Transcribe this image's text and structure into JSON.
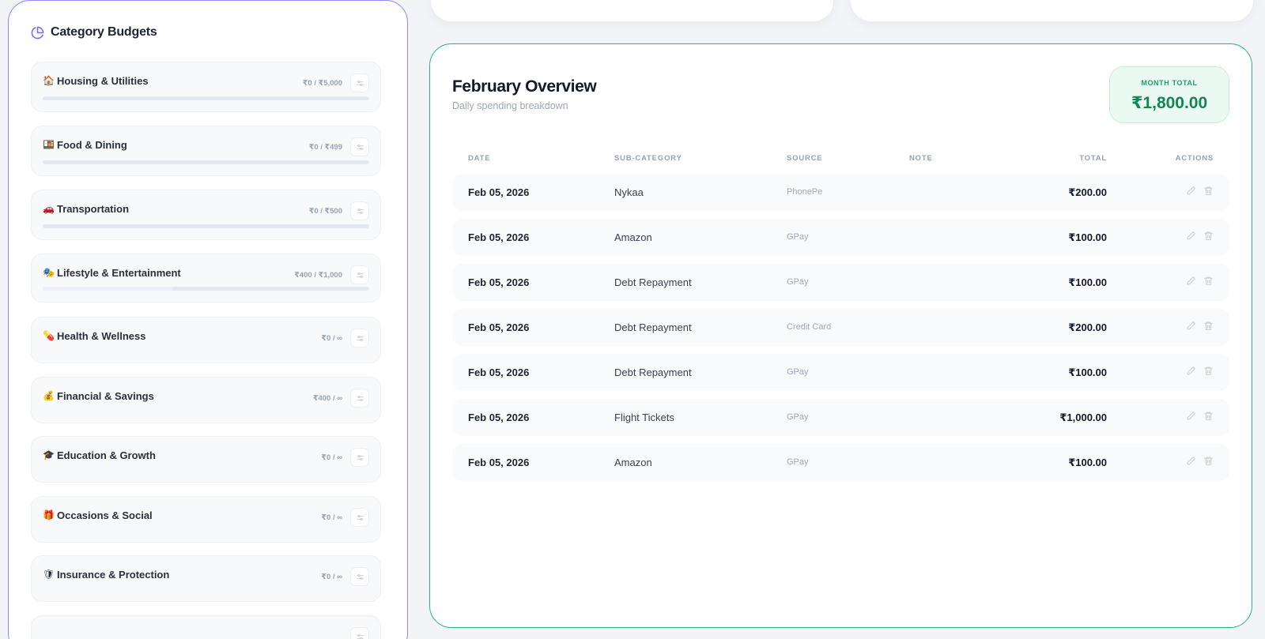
{
  "budgets": {
    "title": "Category Budgets",
    "icon": "pie-chart-icon",
    "items": [
      {
        "emoji": "🏠",
        "name": "Housing & Utilities",
        "amount": "₹0 / ₹5,000",
        "progress": 0,
        "has_bar": true
      },
      {
        "emoji": "🍱",
        "name": "Food & Dining",
        "amount": "₹0 / ₹499",
        "progress": 0,
        "has_bar": true
      },
      {
        "emoji": "🚗",
        "name": "Transportation",
        "amount": "₹0 / ₹500",
        "progress": 0,
        "has_bar": true
      },
      {
        "emoji": "🎭",
        "name": "Lifestyle & Entertainment",
        "amount": "₹400 / ₹1,000",
        "progress": 0.4,
        "has_bar": true
      },
      {
        "emoji": "💊",
        "name": "Health & Wellness",
        "amount": "₹0 / ∞",
        "progress": null,
        "has_bar": false
      },
      {
        "emoji": "💰",
        "name": "Financial & Savings",
        "amount": "₹400 / ∞",
        "progress": null,
        "has_bar": false
      },
      {
        "emoji": "🎓",
        "name": "Education & Growth",
        "amount": "₹0 / ∞",
        "progress": null,
        "has_bar": false
      },
      {
        "emoji": "🎁",
        "name": "Occasions & Social",
        "amount": "₹0 / ∞",
        "progress": null,
        "has_bar": false
      },
      {
        "emoji": "🛡",
        "name": "Insurance & Protection",
        "amount": "₹0 / ∞",
        "progress": null,
        "has_bar": false
      }
    ]
  },
  "overview": {
    "title": "February Overview",
    "subtitle": "Daily spending breakdown",
    "month_total_label": "MONTH TOTAL",
    "month_total_value": "₹1,800.00",
    "columns": {
      "date": "DATE",
      "sub_category": "SUB-CATEGORY",
      "source": "SOURCE",
      "note": "NOTE",
      "total": "TOTAL",
      "actions": "ACTIONS"
    },
    "rows": [
      {
        "date": "Feb 05, 2026",
        "sub_category": "Nykaa",
        "source": "PhonePe",
        "note": "",
        "total": "₹200.00"
      },
      {
        "date": "Feb 05, 2026",
        "sub_category": "Amazon",
        "source": "GPay",
        "note": "",
        "total": "₹100.00"
      },
      {
        "date": "Feb 05, 2026",
        "sub_category": "Debt Repayment",
        "source": "GPay",
        "note": "",
        "total": "₹100.00"
      },
      {
        "date": "Feb 05, 2026",
        "sub_category": "Debt Repayment",
        "source": "Credit Card",
        "note": "",
        "total": "₹200.00"
      },
      {
        "date": "Feb 05, 2026",
        "sub_category": "Debt Repayment",
        "source": "GPay",
        "note": "",
        "total": "₹100.00"
      },
      {
        "date": "Feb 05, 2026",
        "sub_category": "Flight Tickets",
        "source": "GPay",
        "note": "",
        "total": "₹1,000.00"
      },
      {
        "date": "Feb 05, 2026",
        "sub_category": "Amazon",
        "source": "GPay",
        "note": "",
        "total": "₹100.00"
      }
    ]
  },
  "colors": {
    "accent_indigo": "#8b8cf7",
    "accent_green": "#22b77b",
    "total_green": "#168554"
  }
}
